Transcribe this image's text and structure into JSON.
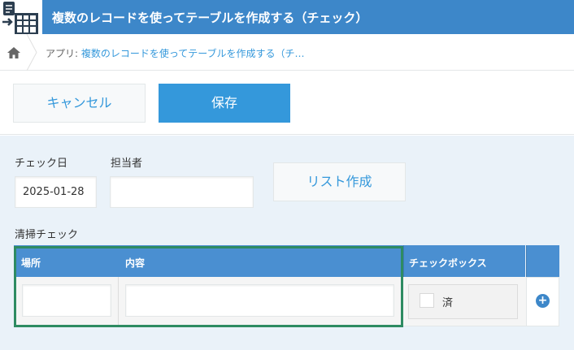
{
  "header": {
    "title": "複数のレコードを使ってテーブルを作成する（チェック）",
    "icon": "table-grid-icon",
    "color": "#3d87c9"
  },
  "breadcrumb": {
    "prefix": "アプリ:",
    "app_link": "複数のレコードを使ってテーブルを作成する（チ…"
  },
  "toolbar": {
    "cancel_label": "キャンセル",
    "save_label": "保存"
  },
  "form": {
    "check_date_label": "チェック日",
    "check_date_value": "2025-01-28",
    "assignee_label": "担当者",
    "assignee_value": "",
    "list_button_label": "リスト作成",
    "table_label": "清掃チェック"
  },
  "table": {
    "columns": [
      "場所",
      "内容",
      "チェックボックス"
    ],
    "rows": [
      {
        "place": "",
        "content": "",
        "checkbox_option": "済",
        "checked": false
      }
    ]
  },
  "colors": {
    "accent": "#3498db",
    "header": "#3d87c9",
    "highlight": "#2e8b62",
    "form_bg": "#eaf2f9"
  }
}
